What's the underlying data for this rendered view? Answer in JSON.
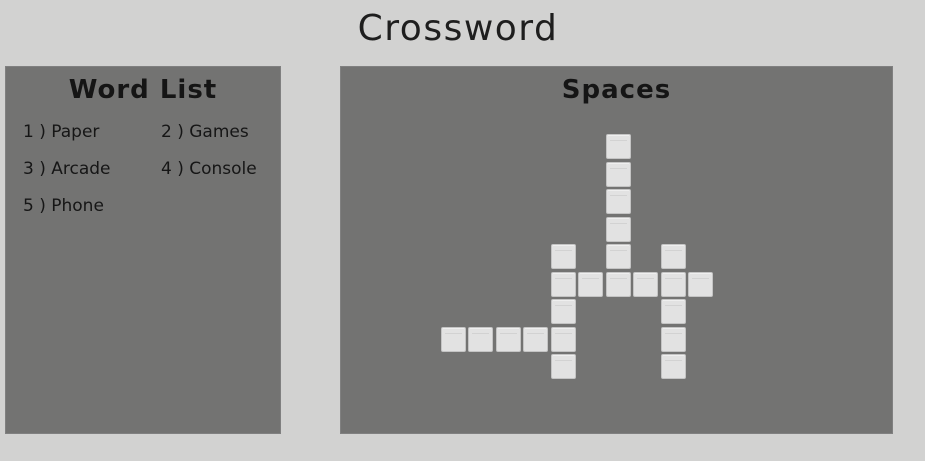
{
  "title": "Crossword",
  "word_list": {
    "heading": "Word List",
    "items": [
      {
        "number": "1",
        "word": "Paper",
        "label": "1 ) Paper"
      },
      {
        "number": "2",
        "word": "Games",
        "label": "2 ) Games"
      },
      {
        "number": "3",
        "word": "Arcade",
        "label": "3 ) Arcade"
      },
      {
        "number": "4",
        "word": "Console",
        "label": "4 ) Console"
      },
      {
        "number": "5",
        "word": "Phone",
        "label": "5 ) Phone"
      }
    ]
  },
  "spaces": {
    "heading": "Spaces",
    "cell_count": 23
  },
  "colors": {
    "background": "#d2d2d1",
    "panel": "#737372",
    "cell": "#e2e2e2",
    "text": "#1e1e1e"
  }
}
